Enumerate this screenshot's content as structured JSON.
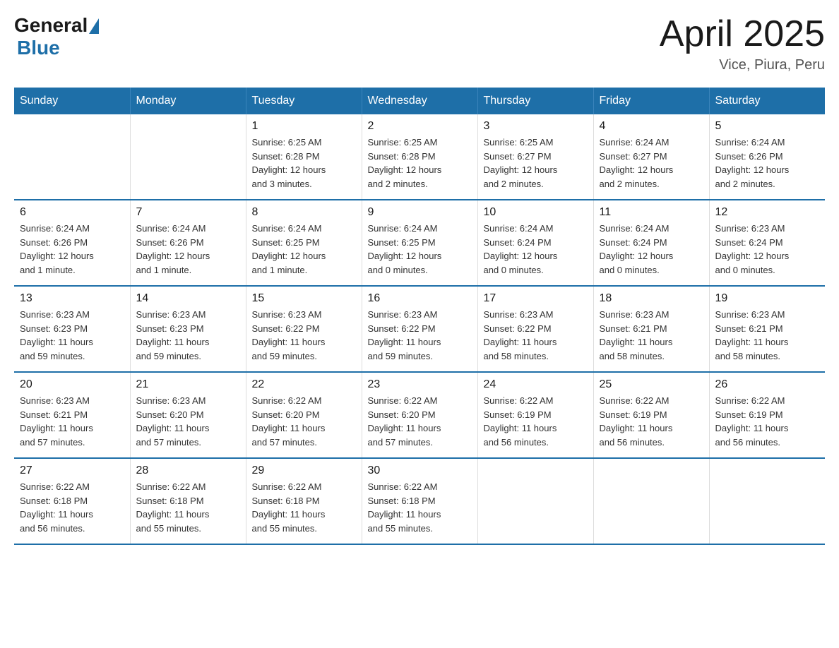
{
  "logo": {
    "general": "General",
    "blue": "Blue"
  },
  "title": "April 2025",
  "subtitle": "Vice, Piura, Peru",
  "weekdays": [
    "Sunday",
    "Monday",
    "Tuesday",
    "Wednesday",
    "Thursday",
    "Friday",
    "Saturday"
  ],
  "weeks": [
    [
      {
        "day": "",
        "info": ""
      },
      {
        "day": "",
        "info": ""
      },
      {
        "day": "1",
        "info": "Sunrise: 6:25 AM\nSunset: 6:28 PM\nDaylight: 12 hours\nand 3 minutes."
      },
      {
        "day": "2",
        "info": "Sunrise: 6:25 AM\nSunset: 6:28 PM\nDaylight: 12 hours\nand 2 minutes."
      },
      {
        "day": "3",
        "info": "Sunrise: 6:25 AM\nSunset: 6:27 PM\nDaylight: 12 hours\nand 2 minutes."
      },
      {
        "day": "4",
        "info": "Sunrise: 6:24 AM\nSunset: 6:27 PM\nDaylight: 12 hours\nand 2 minutes."
      },
      {
        "day": "5",
        "info": "Sunrise: 6:24 AM\nSunset: 6:26 PM\nDaylight: 12 hours\nand 2 minutes."
      }
    ],
    [
      {
        "day": "6",
        "info": "Sunrise: 6:24 AM\nSunset: 6:26 PM\nDaylight: 12 hours\nand 1 minute."
      },
      {
        "day": "7",
        "info": "Sunrise: 6:24 AM\nSunset: 6:26 PM\nDaylight: 12 hours\nand 1 minute."
      },
      {
        "day": "8",
        "info": "Sunrise: 6:24 AM\nSunset: 6:25 PM\nDaylight: 12 hours\nand 1 minute."
      },
      {
        "day": "9",
        "info": "Sunrise: 6:24 AM\nSunset: 6:25 PM\nDaylight: 12 hours\nand 0 minutes."
      },
      {
        "day": "10",
        "info": "Sunrise: 6:24 AM\nSunset: 6:24 PM\nDaylight: 12 hours\nand 0 minutes."
      },
      {
        "day": "11",
        "info": "Sunrise: 6:24 AM\nSunset: 6:24 PM\nDaylight: 12 hours\nand 0 minutes."
      },
      {
        "day": "12",
        "info": "Sunrise: 6:23 AM\nSunset: 6:24 PM\nDaylight: 12 hours\nand 0 minutes."
      }
    ],
    [
      {
        "day": "13",
        "info": "Sunrise: 6:23 AM\nSunset: 6:23 PM\nDaylight: 11 hours\nand 59 minutes."
      },
      {
        "day": "14",
        "info": "Sunrise: 6:23 AM\nSunset: 6:23 PM\nDaylight: 11 hours\nand 59 minutes."
      },
      {
        "day": "15",
        "info": "Sunrise: 6:23 AM\nSunset: 6:22 PM\nDaylight: 11 hours\nand 59 minutes."
      },
      {
        "day": "16",
        "info": "Sunrise: 6:23 AM\nSunset: 6:22 PM\nDaylight: 11 hours\nand 59 minutes."
      },
      {
        "day": "17",
        "info": "Sunrise: 6:23 AM\nSunset: 6:22 PM\nDaylight: 11 hours\nand 58 minutes."
      },
      {
        "day": "18",
        "info": "Sunrise: 6:23 AM\nSunset: 6:21 PM\nDaylight: 11 hours\nand 58 minutes."
      },
      {
        "day": "19",
        "info": "Sunrise: 6:23 AM\nSunset: 6:21 PM\nDaylight: 11 hours\nand 58 minutes."
      }
    ],
    [
      {
        "day": "20",
        "info": "Sunrise: 6:23 AM\nSunset: 6:21 PM\nDaylight: 11 hours\nand 57 minutes."
      },
      {
        "day": "21",
        "info": "Sunrise: 6:23 AM\nSunset: 6:20 PM\nDaylight: 11 hours\nand 57 minutes."
      },
      {
        "day": "22",
        "info": "Sunrise: 6:22 AM\nSunset: 6:20 PM\nDaylight: 11 hours\nand 57 minutes."
      },
      {
        "day": "23",
        "info": "Sunrise: 6:22 AM\nSunset: 6:20 PM\nDaylight: 11 hours\nand 57 minutes."
      },
      {
        "day": "24",
        "info": "Sunrise: 6:22 AM\nSunset: 6:19 PM\nDaylight: 11 hours\nand 56 minutes."
      },
      {
        "day": "25",
        "info": "Sunrise: 6:22 AM\nSunset: 6:19 PM\nDaylight: 11 hours\nand 56 minutes."
      },
      {
        "day": "26",
        "info": "Sunrise: 6:22 AM\nSunset: 6:19 PM\nDaylight: 11 hours\nand 56 minutes."
      }
    ],
    [
      {
        "day": "27",
        "info": "Sunrise: 6:22 AM\nSunset: 6:18 PM\nDaylight: 11 hours\nand 56 minutes."
      },
      {
        "day": "28",
        "info": "Sunrise: 6:22 AM\nSunset: 6:18 PM\nDaylight: 11 hours\nand 55 minutes."
      },
      {
        "day": "29",
        "info": "Sunrise: 6:22 AM\nSunset: 6:18 PM\nDaylight: 11 hours\nand 55 minutes."
      },
      {
        "day": "30",
        "info": "Sunrise: 6:22 AM\nSunset: 6:18 PM\nDaylight: 11 hours\nand 55 minutes."
      },
      {
        "day": "",
        "info": ""
      },
      {
        "day": "",
        "info": ""
      },
      {
        "day": "",
        "info": ""
      }
    ]
  ]
}
